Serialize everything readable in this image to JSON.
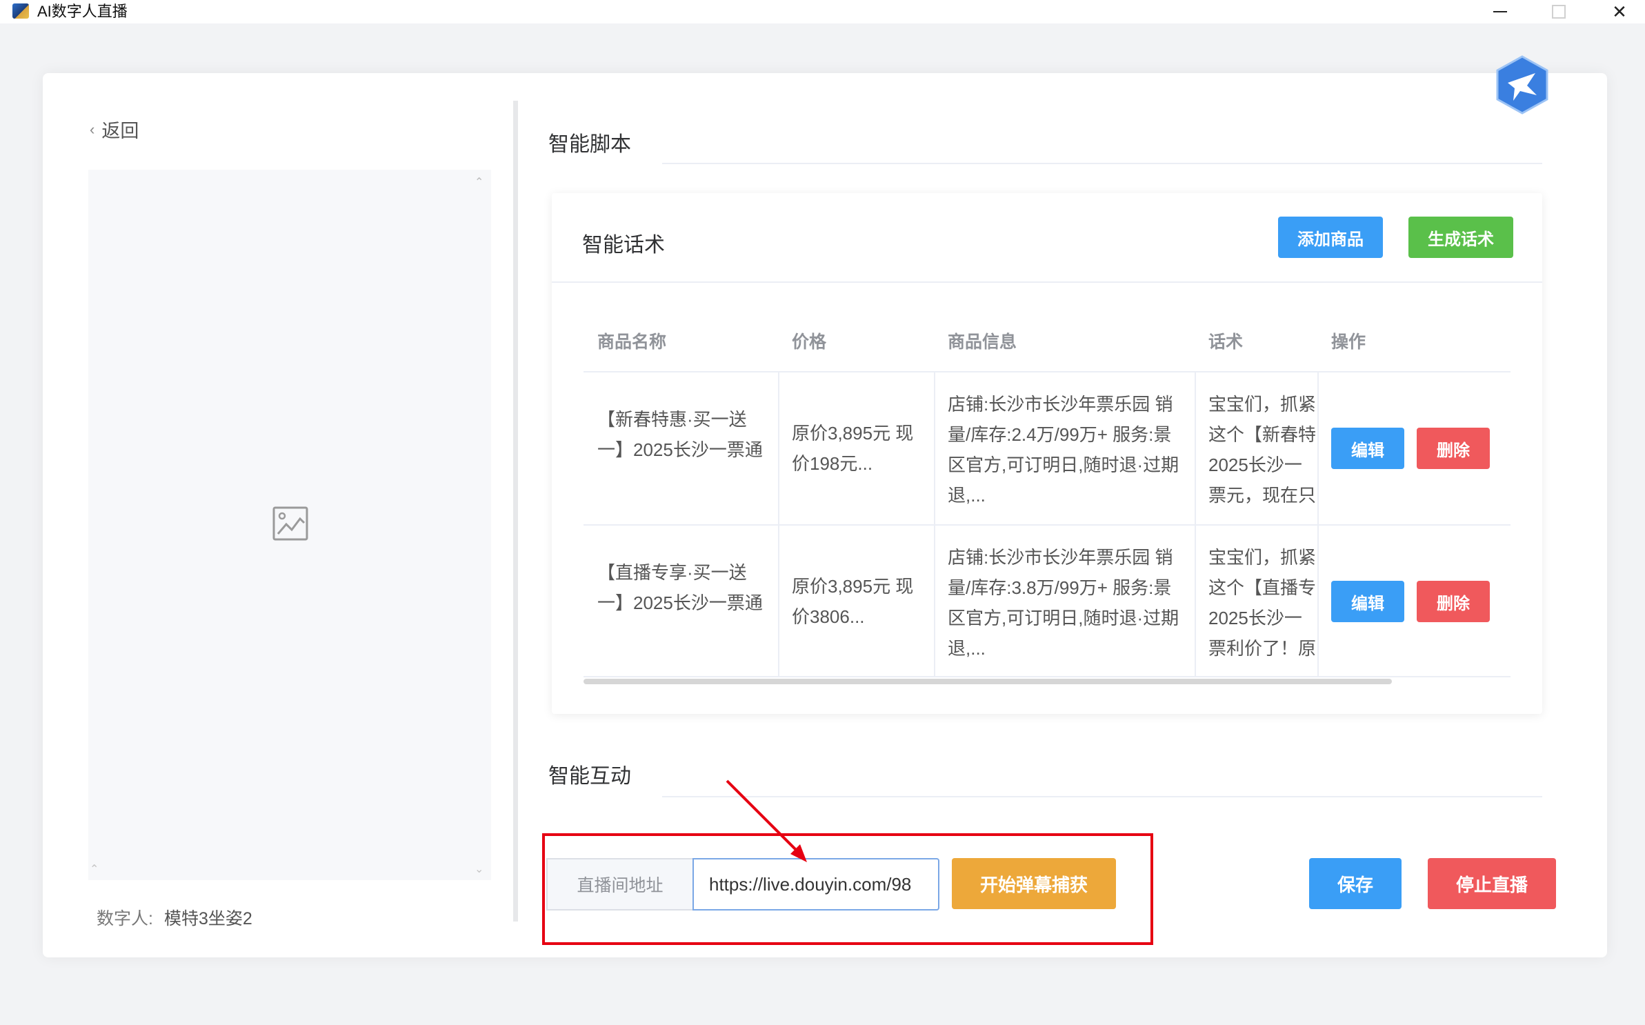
{
  "window": {
    "title": "AI数字人直播",
    "min_icon": "minimize-icon",
    "max_icon": "maximize-icon",
    "close_icon": "close-icon"
  },
  "left_panel": {
    "back_label": "返回",
    "back_icon": "chevron-left-icon",
    "preview_icon": "image-placeholder-icon",
    "digital_human_key": "数字人:",
    "digital_human_value": "模特3坐姿2"
  },
  "script_section": {
    "title": "智能脚本"
  },
  "talk_section": {
    "title": "智能话术",
    "add_product_label": "添加商品",
    "generate_label": "生成话术",
    "table": {
      "headers": [
        "商品名称",
        "价格",
        "商品信息",
        "话术",
        "操作"
      ],
      "rows": [
        {
          "name": "【新春特惠·买一送一】2025长沙一票通",
          "price": "原价3,895元 现价198元...",
          "info": "店铺:长沙市长沙年票乐园 销量/库存:2.4万/99万+ 服务:景区官方,可订明日,随时退·过期退,...",
          "script": "宝宝们，抓紧这个【新春特2025长沙一票元，现在只要",
          "edit_label": "编辑",
          "delete_label": "删除"
        },
        {
          "name": "【直播专享·买一送一】2025长沙一票通",
          "price": "原价3,895元 现价3806...",
          "info": "店铺:长沙市长沙年票乐园 销量/库存:3.8万/99万+ 服务:景区官方,可订明日,随时退·过期退,...",
          "script": "宝宝们，抓紧这个【直播专2025长沙一票利价了！原价",
          "edit_label": "编辑",
          "delete_label": "删除"
        }
      ]
    }
  },
  "interact_section": {
    "title": "智能互动",
    "address_label": "直播间地址",
    "address_value": "https://live.douyin.com/98",
    "start_capture_label": "开始弹幕捕获",
    "save_label": "保存",
    "stop_live_label": "停止直播"
  },
  "colors": {
    "primary_blue": "#3a9ef6",
    "success_green": "#5ac04a",
    "danger_red": "#f0595c",
    "warning_orange": "#eda83a",
    "highlight_red": "#e60012"
  }
}
